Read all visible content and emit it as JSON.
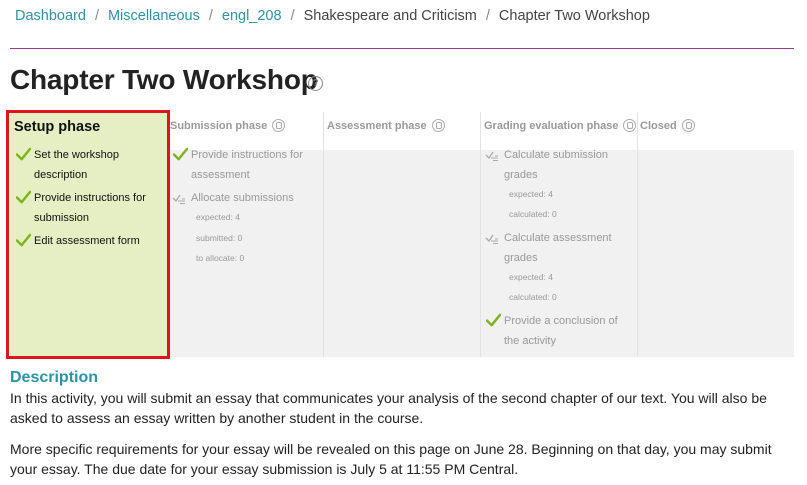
{
  "breadcrumb": {
    "items": [
      "Dashboard",
      "Miscellaneous",
      "engl_208",
      "Shakespeare and Criticism",
      "Chapter Two Workshop"
    ],
    "separator": "/"
  },
  "page": {
    "title": "Chapter Two Workshop",
    "help_glyph": "?"
  },
  "phases": [
    {
      "name": "Setup phase",
      "tasks": [
        {
          "label": "Set the workshop description",
          "lines": [
            "Set the workshop",
            "description"
          ]
        },
        {
          "label": "Provide instructions for submission",
          "lines": [
            "Provide instructions for",
            "submission"
          ]
        },
        {
          "label": "Edit assessment form",
          "lines": [
            "Edit assessment form"
          ]
        }
      ]
    },
    {
      "name": "Submission phase",
      "tasks": [
        {
          "label": "Provide instructions for assessment",
          "lines": [
            "Provide instructions for",
            "assessment"
          ]
        },
        {
          "label": "Allocate submissions",
          "lines": [
            "Allocate submissions"
          ],
          "details": [
            "expected: 4",
            "submitted: 0",
            "to allocate: 0"
          ]
        }
      ]
    },
    {
      "name": "Assessment phase",
      "tasks": []
    },
    {
      "name": "Grading evaluation phase",
      "tasks": [
        {
          "label": "Calculate submission grades",
          "lines": [
            "Calculate submission",
            "grades"
          ],
          "details": [
            "expected: 4",
            "calculated: 0"
          ]
        },
        {
          "label": "Calculate assessment grades",
          "lines": [
            "Calculate assessment",
            "grades"
          ],
          "details": [
            "expected: 4",
            "calculated: 0"
          ]
        },
        {
          "label": "Provide a conclusion of the activity",
          "lines": [
            "Provide a conclusion of",
            "the activity"
          ]
        }
      ]
    },
    {
      "name": "Closed",
      "tasks": []
    }
  ],
  "description": {
    "heading": "Description",
    "paragraph1": "In this activity, you will submit an essay that communicates your analysis of the second chapter of our text.  You will also be asked to assess an essay written by another student in the course.",
    "paragraph2": "More specific requirements for your essay will be revealed on this page on June 28.  Beginning on that day, you may submit your essay.  The due date for your essay submission is July 5 at 11:55 PM Central."
  },
  "icons": {
    "check": "check-icon",
    "todo": "todo-icon",
    "phase_info": "lightbulb-icon",
    "help": "help-icon"
  },
  "colors": {
    "accent": "#2a93a8",
    "divider": "#9b3d8a",
    "active_phase_bg": "#e6efc4",
    "check": "#7cb518",
    "highlight_border": "#e0141d"
  }
}
